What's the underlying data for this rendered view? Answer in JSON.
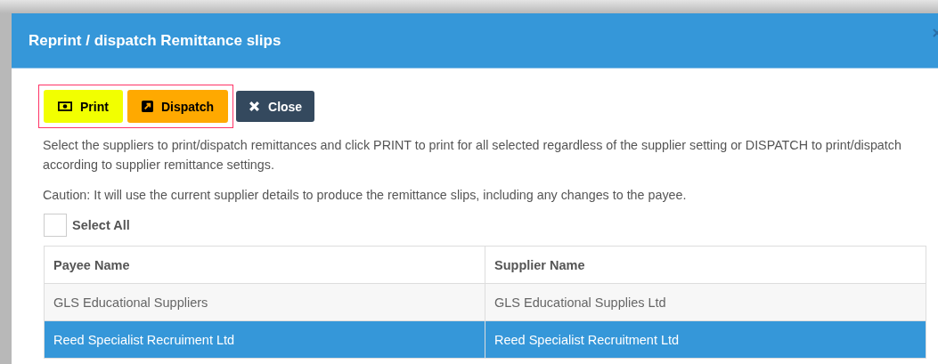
{
  "dialog": {
    "title": "Reprint / dispatch Remittance slips"
  },
  "buttons": [
    {
      "kind": "print",
      "label": "Print"
    },
    {
      "kind": "dispatch",
      "label": "Dispatch"
    },
    {
      "kind": "close",
      "label": "Close"
    }
  ],
  "instructions": "Select the suppliers to print/dispatch remittances and click PRINT to print for all selected regardless of the supplier setting or DISPATCH to print/dispatch according to supplier remittance settings.",
  "caution": "Caution: It will use the current supplier details to produce the remittance slips, including any changes to the payee.",
  "select_all": {
    "label": "Select All",
    "checked": false
  },
  "table": {
    "columns": [
      "Payee Name",
      "Supplier Name"
    ],
    "rows": [
      {
        "cells": [
          "GLS Educational Suppliers",
          "GLS Educational Supplies Ltd"
        ],
        "selected": false
      },
      {
        "cells": [
          "Reed Specialist Recruiment Ltd",
          "Reed Specialist Recruitment Ltd"
        ],
        "selected": true
      }
    ]
  }
}
